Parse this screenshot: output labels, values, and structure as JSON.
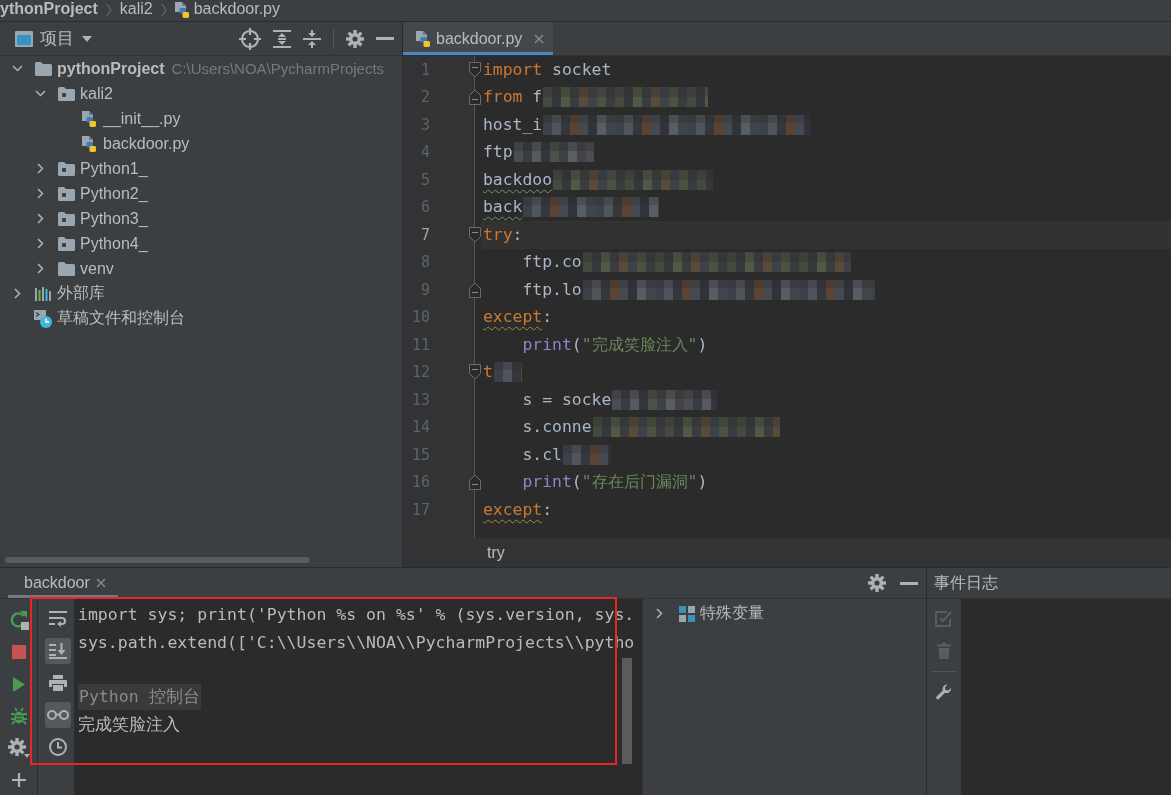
{
  "navigation_bar": {
    "items": [
      {
        "label": "ythonProject",
        "kind": "project"
      },
      {
        "label": "kali2",
        "kind": "folder"
      },
      {
        "label": "backdoor.py",
        "kind": "python_file"
      }
    ]
  },
  "project_panel": {
    "title": "项目",
    "tree": [
      {
        "label": "pythonProject",
        "path": "C:\\Users\\NOA\\PycharmProjects",
        "kind": "root",
        "expanded": true,
        "children": [
          {
            "label": "kali2",
            "kind": "package",
            "expanded": true,
            "children": [
              {
                "label": "__init__.py",
                "kind": "python_file"
              },
              {
                "label": "backdoor.py",
                "kind": "python_file"
              }
            ]
          },
          {
            "label": "Python1_",
            "kind": "package",
            "expanded": false
          },
          {
            "label": "Python2_",
            "kind": "package",
            "expanded": false
          },
          {
            "label": "Python3_",
            "kind": "package",
            "expanded": false
          },
          {
            "label": "Python4_",
            "kind": "package",
            "expanded": false
          },
          {
            "label": "venv",
            "kind": "folder",
            "expanded": false
          }
        ]
      },
      {
        "label": "外部库",
        "kind": "library",
        "expanded": false
      },
      {
        "label": "草稿文件和控制台",
        "kind": "scratches"
      }
    ]
  },
  "editor": {
    "tabs": [
      {
        "label": "backdoor.py",
        "selected": true
      }
    ],
    "lines": [
      {
        "number": "1",
        "kind": "opening",
        "current": false,
        "redacted": false,
        "tokens": [
          {
            "kind": "keyword",
            "text": "import"
          },
          {
            "kind": "plain",
            "text": " socket"
          }
        ]
      },
      {
        "number": "2",
        "kind": "closing",
        "current": false,
        "redacted": true,
        "tokens": [
          {
            "kind": "keyword",
            "text": "from"
          },
          {
            "kind": "plain",
            "text": " f"
          }
        ]
      },
      {
        "number": "3",
        "kind": "plain",
        "current": false,
        "redacted": true,
        "tokens": [
          {
            "kind": "plain",
            "text": "host_i"
          }
        ]
      },
      {
        "number": "4",
        "kind": "plain",
        "current": false,
        "redacted": true,
        "tokens": [
          {
            "kind": "plain",
            "text": "ftp"
          }
        ]
      },
      {
        "number": "5",
        "kind": "plain",
        "current": false,
        "redacted": true,
        "tokens": [
          {
            "kind": "misspelt",
            "text": "backdoo"
          }
        ]
      },
      {
        "number": "6",
        "kind": "plain",
        "current": false,
        "redacted": true,
        "tokens": [
          {
            "kind": "misspelt",
            "text": "back"
          }
        ]
      },
      {
        "number": "7",
        "kind": "opening",
        "current": true,
        "redacted": false,
        "tokens": [
          {
            "kind": "keyword",
            "text": "try"
          },
          {
            "kind": "plain",
            "text": ":"
          }
        ],
        "children": [
          {
            "number": "8",
            "kind": "plain",
            "current": false,
            "redacted": true,
            "tokens": [
              {
                "kind": "plain",
                "text": "ftp.co"
              }
            ]
          },
          {
            "number": "9",
            "kind": "closing",
            "current": false,
            "redacted": true,
            "tokens": [
              {
                "kind": "plain",
                "text": "ftp.lo"
              }
            ]
          }
        ]
      },
      {
        "number": "10",
        "kind": "plain",
        "current": false,
        "redacted": false,
        "tokens": [
          {
            "kind": "flagged",
            "text": "except"
          },
          {
            "kind": "plain",
            "text": ":"
          }
        ],
        "children": [
          {
            "number": "11",
            "kind": "plain",
            "current": false,
            "redacted": false,
            "tokens": [
              {
                "kind": "builtin",
                "text": "print"
              },
              {
                "kind": "plain",
                "text": "("
              },
              {
                "kind": "string",
                "text": "\"完成笑脸注入\""
              },
              {
                "kind": "plain",
                "text": ")"
              }
            ]
          }
        ]
      },
      {
        "number": "12",
        "kind": "opening",
        "current": false,
        "redacted": true,
        "tokens": [
          {
            "kind": "keyword",
            "text": "t"
          }
        ],
        "children": [
          {
            "number": "13",
            "kind": "plain",
            "current": false,
            "redacted": true,
            "tokens": [
              {
                "kind": "plain",
                "text": "s = socke"
              }
            ]
          },
          {
            "number": "14",
            "kind": "plain",
            "current": false,
            "redacted": true,
            "tokens": [
              {
                "kind": "plain",
                "text": "s.conne"
              }
            ]
          },
          {
            "number": "15",
            "kind": "plain",
            "current": false,
            "redacted": true,
            "tokens": [
              {
                "kind": "plain",
                "text": "s.cl"
              }
            ]
          },
          {
            "number": "16",
            "kind": "closing",
            "current": false,
            "redacted": false,
            "tokens": [
              {
                "kind": "builtin",
                "text": "print"
              },
              {
                "kind": "plain",
                "text": "("
              },
              {
                "kind": "string",
                "text": "\"存在后门漏洞\""
              },
              {
                "kind": "plain",
                "text": ")"
              }
            ]
          }
        ]
      },
      {
        "number": "17",
        "kind": "plain",
        "current": false,
        "redacted": false,
        "tokens": [
          {
            "kind": "flagged",
            "text": "except"
          },
          {
            "kind": "plain",
            "text": ":"
          }
        ]
      }
    ],
    "breadcrumb": [
      "try"
    ]
  },
  "run_panel": {
    "tabs": [
      {
        "label": "backdoor",
        "selected": true
      }
    ],
    "console_toolbar": [
      {
        "on": false
      },
      {
        "on": true
      },
      {
        "on": false
      },
      {
        "on": true
      },
      {
        "on": false
      }
    ],
    "console": [
      {
        "kind": "input",
        "text": "import sys; print('Python %s on %s' % (sys.version, sys."
      },
      {
        "kind": "input",
        "text": "sys.path.extend(['C:\\\\Users\\\\NOA\\\\PycharmProjects\\\\pytho"
      },
      {
        "kind": "banner",
        "text": "Python 控制台"
      },
      {
        "kind": "output",
        "text": "完成笑脸注入"
      }
    ],
    "variables": [
      {
        "label": "特殊变量",
        "expanded": false
      }
    ]
  },
  "event_log": {
    "title": "事件日志",
    "tools": [
      {
        "disabled": true
      },
      {
        "disabled": true
      },
      {
        "disabled": false
      }
    ]
  },
  "annotation": {
    "kind": "rectangle"
  }
}
